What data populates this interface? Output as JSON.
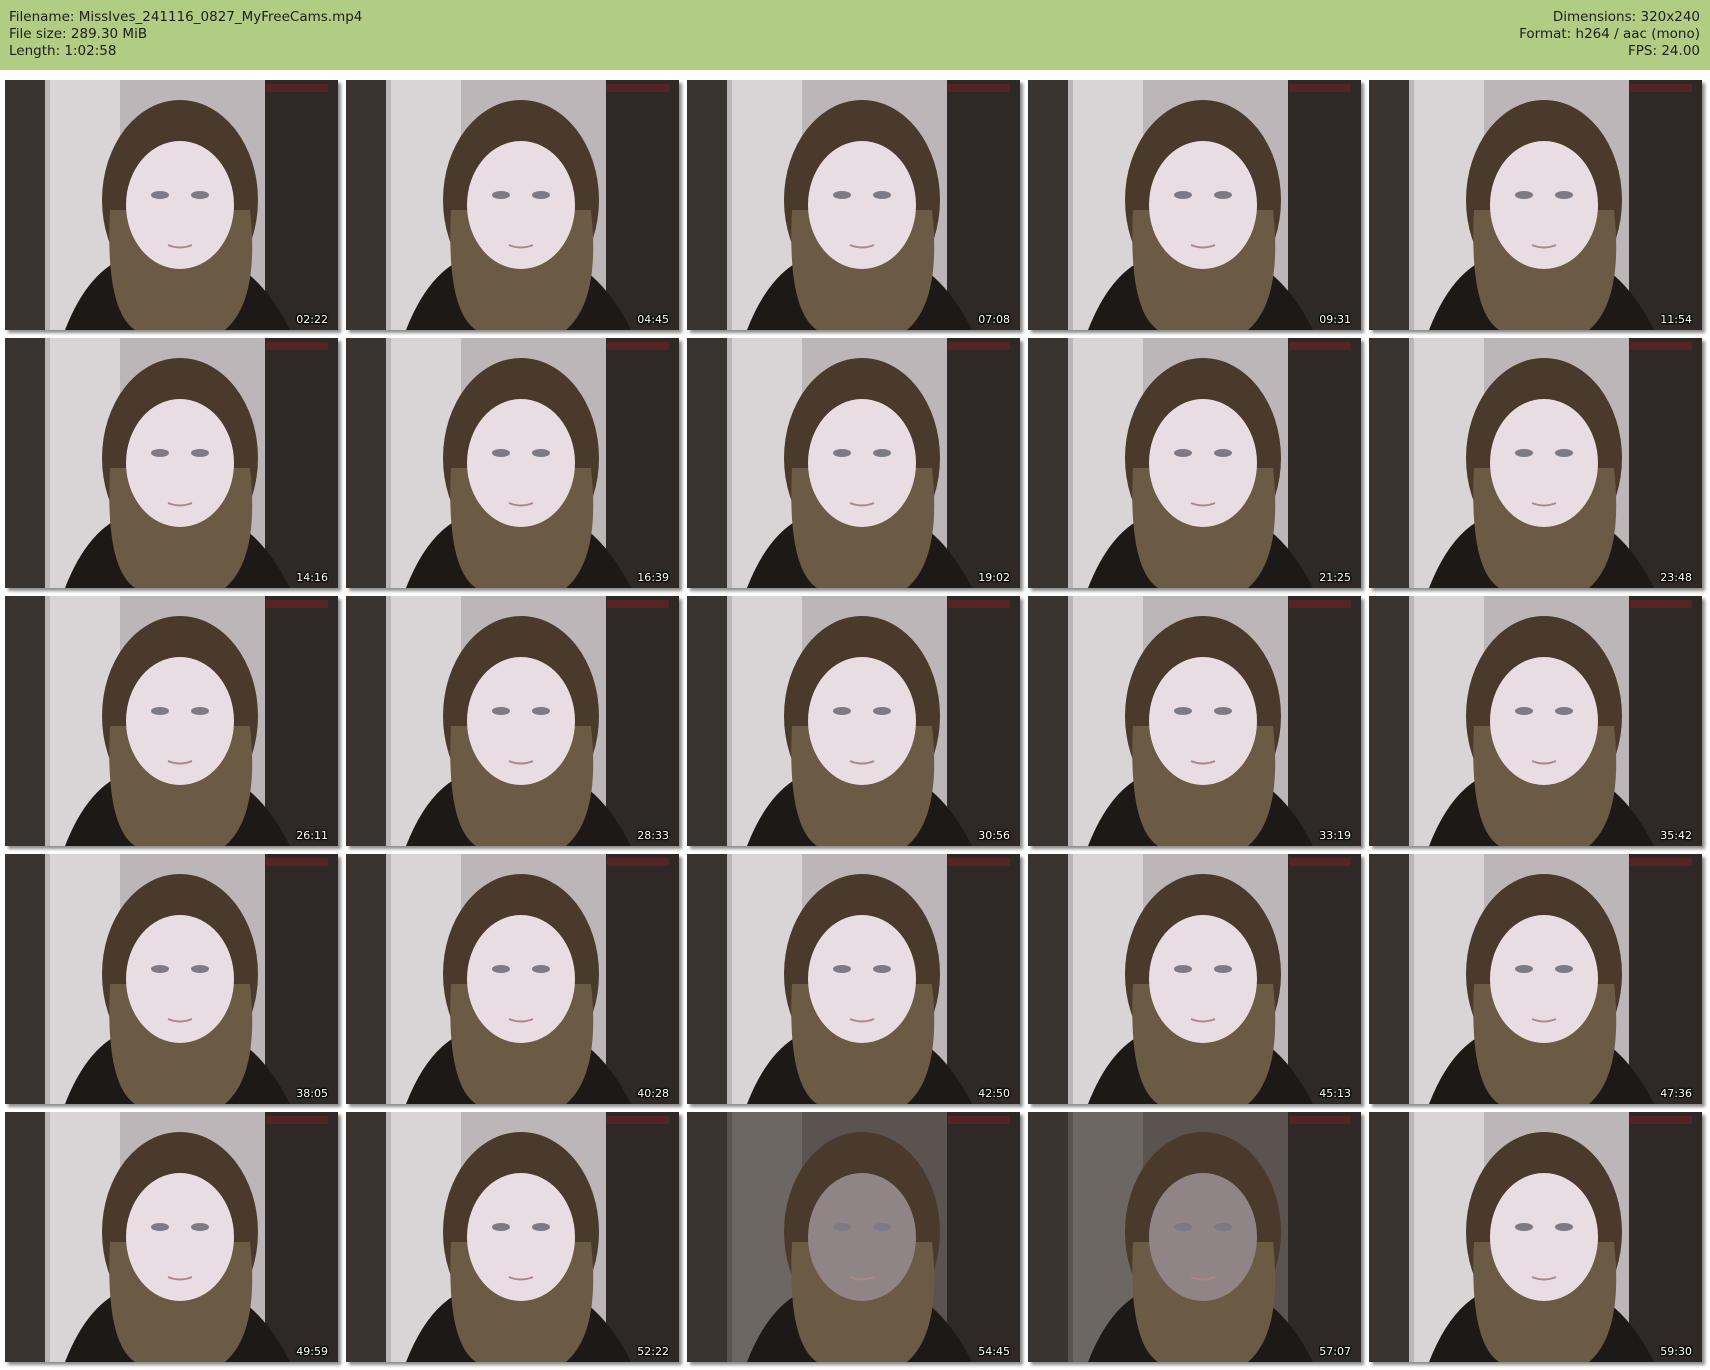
{
  "header": {
    "left": [
      "Filename: MissIves_241116_0827_MyFreeCams.mp4",
      "File size: 289.30 MiB",
      "Length: 1:02:58"
    ],
    "right": [
      "Dimensions: 320x240",
      "Format: h264 / aac (mono)",
      "FPS: 24.00"
    ]
  },
  "colors": {
    "header_bg": "#b1cc83",
    "page_bg": "#ffffff"
  },
  "thumbnails": [
    {
      "timestamp": "02:22"
    },
    {
      "timestamp": "04:45"
    },
    {
      "timestamp": "07:08"
    },
    {
      "timestamp": "09:31"
    },
    {
      "timestamp": "11:54"
    },
    {
      "timestamp": "14:16"
    },
    {
      "timestamp": "16:39"
    },
    {
      "timestamp": "19:02"
    },
    {
      "timestamp": "21:25"
    },
    {
      "timestamp": "23:48"
    },
    {
      "timestamp": "26:11"
    },
    {
      "timestamp": "28:33"
    },
    {
      "timestamp": "30:56"
    },
    {
      "timestamp": "33:19"
    },
    {
      "timestamp": "35:42"
    },
    {
      "timestamp": "38:05"
    },
    {
      "timestamp": "40:28"
    },
    {
      "timestamp": "42:50"
    },
    {
      "timestamp": "45:13"
    },
    {
      "timestamp": "47:36"
    },
    {
      "timestamp": "49:59"
    },
    {
      "timestamp": "52:22"
    },
    {
      "timestamp": "54:45"
    },
    {
      "timestamp": "57:07"
    },
    {
      "timestamp": "59:30"
    }
  ]
}
